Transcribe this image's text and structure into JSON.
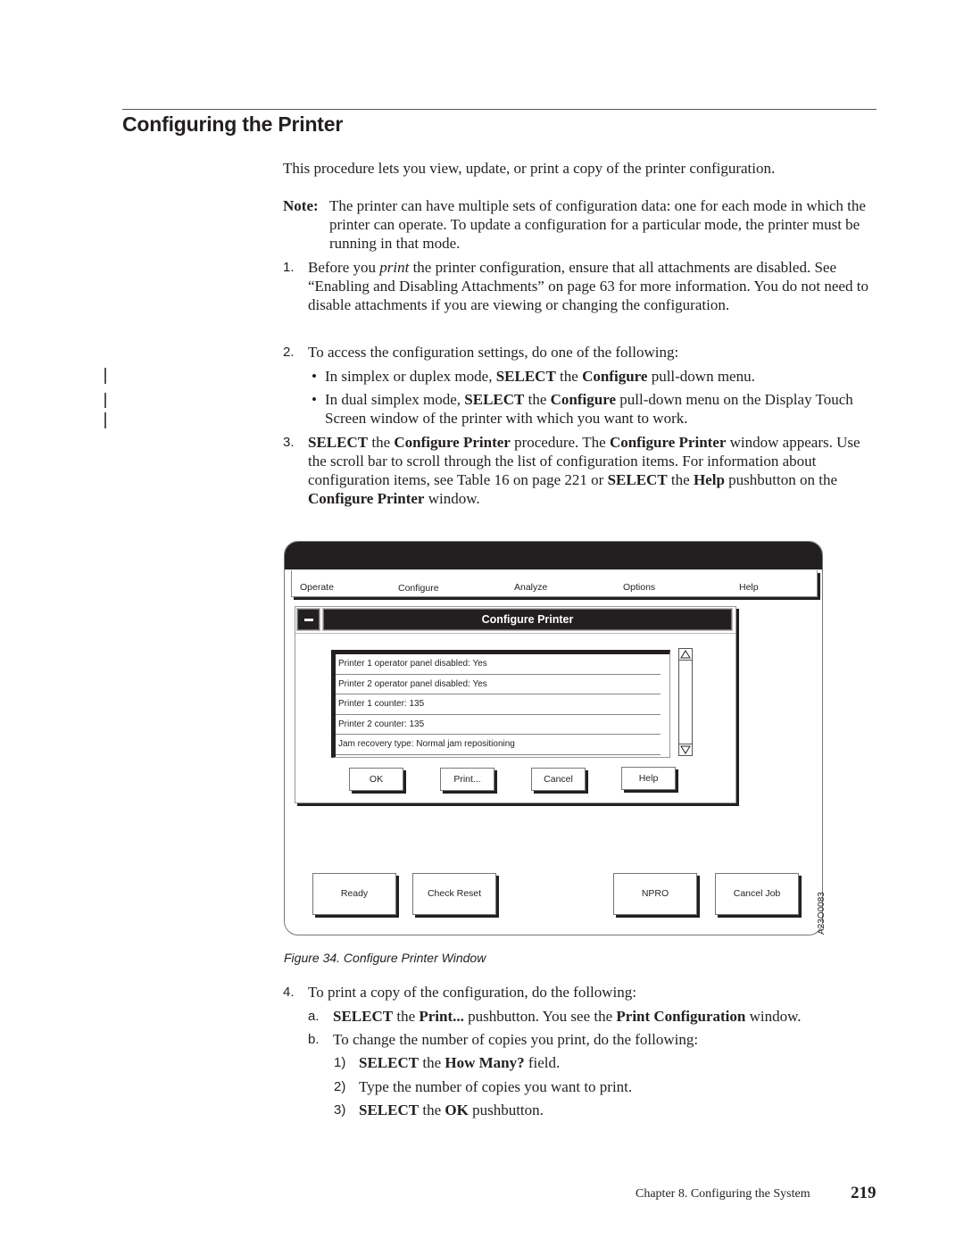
{
  "page": {
    "heading": "Configuring the Printer",
    "intro": "This procedure lets you view, update, or print a copy of the printer configuration.",
    "note": {
      "label": "Note:",
      "text": "The printer can have multiple sets of configuration data: one for each mode in which the printer can operate. To update a configuration for a particular mode, the printer must be running in that mode."
    },
    "steps": [
      {
        "num": "1.",
        "parts": [
          "Before you ",
          "print",
          " the printer configuration, ensure that all attachments are disabled. See “Enabling and Disabling Attachments” on page 63 for more information. You do not need to disable attachments if you are viewing or changing the configuration."
        ]
      },
      {
        "num": "2.",
        "text": "To access the configuration settings, do one of the following:",
        "bullets": [
          {
            "dot": "•",
            "parts": [
              "In simplex or duplex mode, ",
              "SELECT",
              " the ",
              "Configure",
              " pull-down menu."
            ]
          },
          {
            "dot": "•",
            "parts": [
              "In dual simplex mode, ",
              "SELECT",
              " the ",
              "Configure",
              " pull-down menu on the Display Touch Screen window of the printer with which you want to work."
            ]
          }
        ]
      },
      {
        "num": "3.",
        "parts": [
          "SELECT",
          " the ",
          "Configure Printer",
          " procedure. The ",
          "Configure Printer",
          " window appears. Use the scroll bar to scroll through the list of configuration items. For information about configuration items, see Table 16 on page 221 or ",
          "SELECT",
          " the ",
          "Help",
          " pushbutton on the ",
          "Configure Printer",
          " window."
        ]
      },
      {
        "num": "4.",
        "text": "To print a copy of the configuration, do the following:",
        "substeps": [
          {
            "num": "a.",
            "parts": [
              "SELECT",
              " the ",
              "Print...",
              " pushbutton. You see the ",
              "Print Configuration",
              " window."
            ]
          },
          {
            "num": "b.",
            "text": "To change the number of copies you print, do the following:"
          }
        ],
        "subsubsteps": [
          {
            "num": "1)",
            "parts": [
              "SELECT",
              " the ",
              "How Many?",
              " field."
            ]
          },
          {
            "num": "2)",
            "text": "Type the number of copies you want to print."
          },
          {
            "num": "3)",
            "parts": [
              "SELECT",
              " the ",
              "OK",
              " pushbutton."
            ]
          }
        ]
      }
    ]
  },
  "figure": {
    "menu": [
      "Operate",
      "Configure",
      "Analyze",
      "Options",
      "Help"
    ],
    "dialog": {
      "title": "Configure Printer",
      "sysmenu_icon": "minus-icon",
      "list_items": [
        "Printer 1 operator panel disabled: Yes",
        "Printer 2 operator panel disabled: Yes",
        "Printer 1 counter: 135",
        "Printer 2 counter: 135",
        "Jam recovery type: Normal jam repositioning"
      ],
      "scroll_up_icon": "triangle-up-icon",
      "scroll_down_icon": "triangle-down-icon",
      "buttons": [
        "OK",
        "Print...",
        "Cancel",
        "Help"
      ]
    },
    "bottom_buttons": [
      "Ready",
      "Check Reset",
      "NPRO",
      "Cancel Job"
    ],
    "figure_id": "A23O0083",
    "caption": "Figure 34. Configure Printer Window"
  },
  "footer": {
    "chapter": "Chapter 8. Configuring the System",
    "page_number": "219"
  }
}
